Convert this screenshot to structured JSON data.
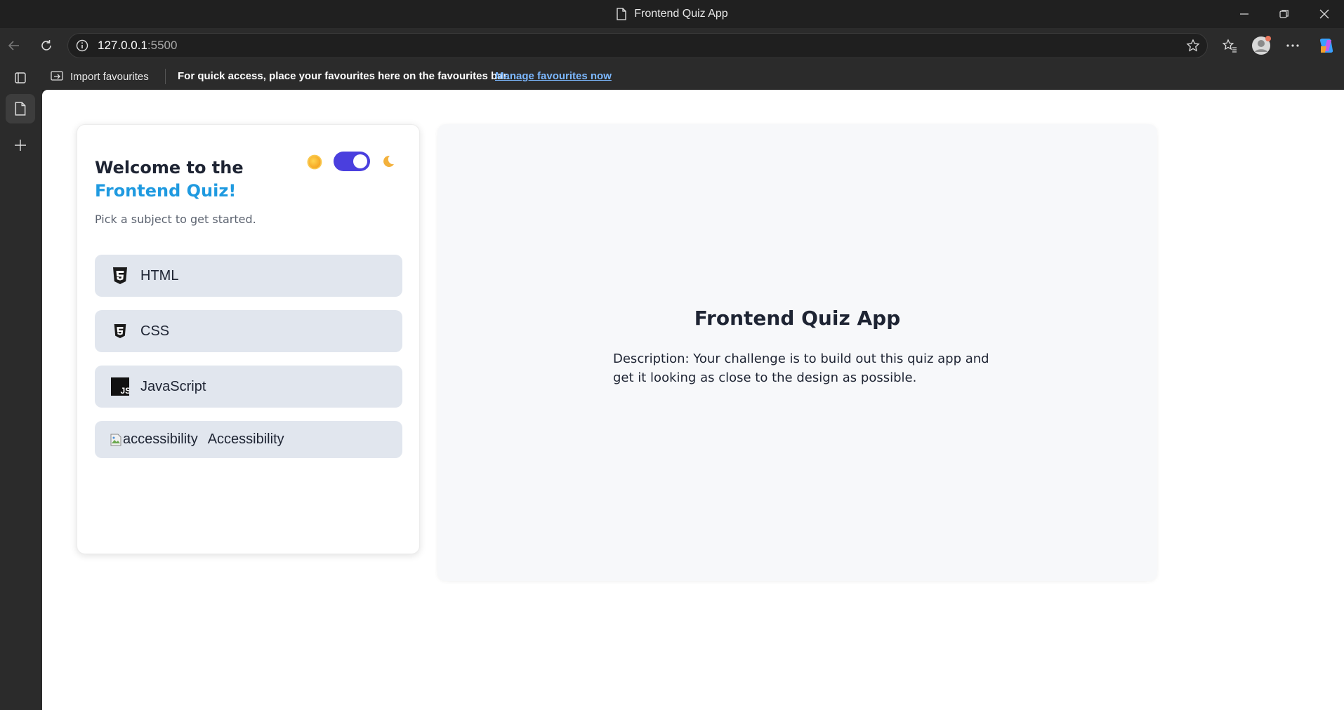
{
  "window": {
    "title": "Frontend Quiz App"
  },
  "browser": {
    "url_host": "127.0.0.1",
    "url_port": ":5500"
  },
  "favourites_bar": {
    "import_label": "Import favourites",
    "message": "For quick access, place your favourites here on the favourites bar.",
    "manage_link": "Manage favourites now"
  },
  "quiz_card": {
    "welcome": "Welcome to the",
    "brand": "Frontend Quiz!",
    "subtitle": "Pick a subject to get started.",
    "theme": {
      "sun_icon": "sun-icon",
      "moon_icon": "moon-icon",
      "dark_mode_on": true,
      "toggle_color": "#4a3fde"
    },
    "subjects": [
      {
        "label": "HTML",
        "icon": "html5-icon"
      },
      {
        "label": "CSS",
        "icon": "css3-icon"
      },
      {
        "label": "JavaScript",
        "icon": "javascript-icon"
      },
      {
        "label": "Accessibility",
        "icon": "broken-image-icon",
        "alt_text": "accessibility"
      }
    ]
  },
  "description_panel": {
    "title": "Frontend Quiz App",
    "description": "Description: Your challenge is to build out this quiz app and get it looking as close to the design as possible."
  },
  "colors": {
    "brand_blue": "#1f9ae0",
    "subject_bg": "#e1e6ee",
    "heading": "#1e2433"
  }
}
